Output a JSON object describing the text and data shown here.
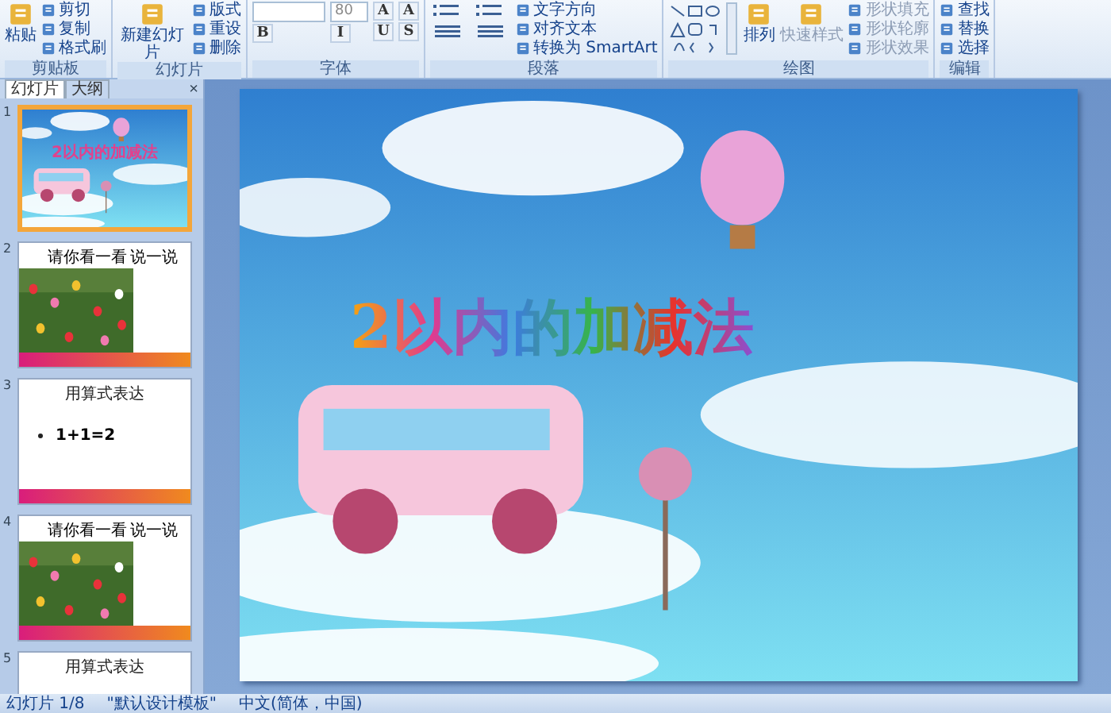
{
  "ribbon": {
    "groups": [
      {
        "label": "剪贴板",
        "columns": [
          [
            {
              "kind": "large",
              "label": "粘贴"
            }
          ],
          [
            {
              "kind": "small",
              "label": "剪切"
            },
            {
              "kind": "small",
              "label": "复制"
            },
            {
              "kind": "small",
              "label": "格式刷"
            }
          ]
        ]
      },
      {
        "label": "幻灯片",
        "columns": [
          [
            {
              "kind": "large",
              "label": "新建幻灯片"
            }
          ],
          [
            {
              "kind": "small",
              "label": "版式"
            },
            {
              "kind": "small",
              "label": "重设"
            },
            {
              "kind": "small",
              "label": "删除"
            }
          ]
        ]
      },
      {
        "label": "字体",
        "columns": [
          [
            {
              "kind": "fontname"
            },
            {
              "kind": "toggle",
              "label": "B"
            }
          ],
          [
            {
              "kind": "fontsize",
              "value": "80"
            },
            {
              "kind": "toggle",
              "label": "I"
            }
          ],
          [
            {
              "kind": "toggle",
              "label": "A"
            },
            {
              "kind": "toggle",
              "label": "U"
            }
          ],
          [
            {
              "kind": "toggle",
              "label": "A"
            },
            {
              "kind": "toggle",
              "label": "S"
            }
          ]
        ]
      },
      {
        "label": "段落",
        "columns": [
          [
            {
              "kind": "bullets"
            },
            {
              "kind": "align"
            }
          ],
          [
            {
              "kind": "bullets"
            },
            {
              "kind": "align"
            }
          ],
          [
            {
              "kind": "small",
              "label": "文字方向"
            },
            {
              "kind": "small",
              "label": "对齐文本"
            },
            {
              "kind": "small",
              "label": "转换为 SmartArt"
            }
          ]
        ]
      },
      {
        "label": "绘图",
        "columns": [
          [
            {
              "kind": "shapes"
            }
          ],
          [
            {
              "kind": "large",
              "label": "排列"
            }
          ],
          [
            {
              "kind": "large",
              "label": "快速样式",
              "disabled": true
            }
          ],
          [
            {
              "kind": "small",
              "label": "形状填充",
              "disabled": true
            },
            {
              "kind": "small",
              "label": "形状轮廓",
              "disabled": true
            },
            {
              "kind": "small",
              "label": "形状效果",
              "disabled": true
            }
          ]
        ]
      },
      {
        "label": "编辑",
        "columns": [
          [
            {
              "kind": "small",
              "label": "查找"
            },
            {
              "kind": "small",
              "label": "替换"
            },
            {
              "kind": "small",
              "label": "选择"
            }
          ]
        ]
      }
    ]
  },
  "panel": {
    "tabs": [
      {
        "label": "幻灯片",
        "selected": true
      },
      {
        "label": "大纲",
        "selected": false
      }
    ],
    "close": "×",
    "slides": [
      {
        "number": "1",
        "kind": "title",
        "selected": true,
        "title": "2以内的加减法"
      },
      {
        "number": "2",
        "selected": false,
        "title": "请你看一看",
        "title_end": "说一说",
        "footer": true
      },
      {
        "number": "3",
        "kind": "text",
        "selected": false,
        "title": "用算式表达",
        "bullet": "1+1=2",
        "footer": true
      },
      {
        "number": "4",
        "selected": false,
        "title": "请你看一看",
        "title_end": "说一说",
        "footer": true
      },
      {
        "number": "5",
        "kind": "text",
        "selected": false,
        "title": "用算式表达"
      }
    ]
  },
  "slide": {
    "title": "2以内的加减法"
  },
  "status_bar": {
    "slide": "幻灯片 1/8",
    "theme": "\"默认设计模板\"",
    "language": "中文(简体，中国)"
  }
}
